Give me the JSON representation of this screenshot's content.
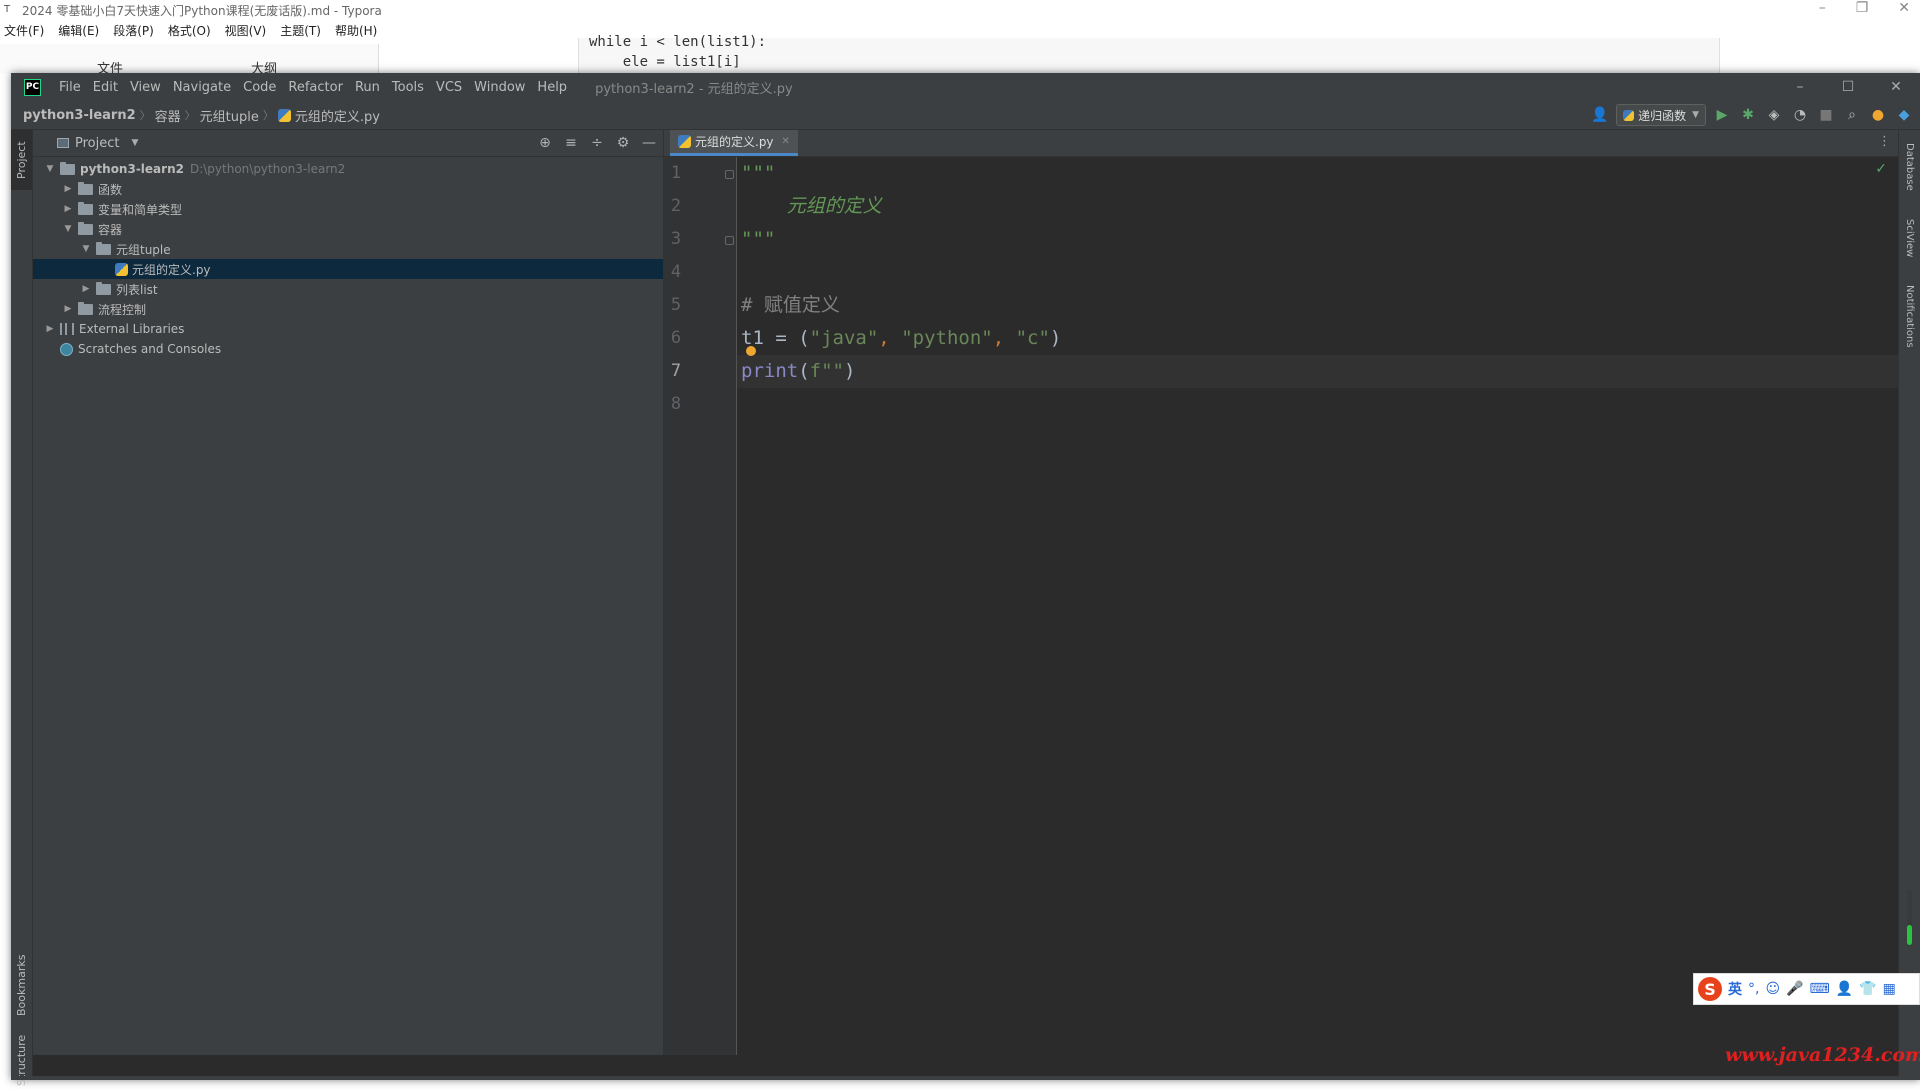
{
  "typora": {
    "title": "2024 零基础小白7天快速入门Python课程(无废话版).md - Typora",
    "menu": [
      "文件(F)",
      "编辑(E)",
      "段落(P)",
      "格式(O)",
      "视图(V)",
      "主题(T)",
      "帮助(H)"
    ],
    "sidebar_tabs": [
      "文件",
      "大纲"
    ],
    "code_lines": [
      "while i < len(list1):",
      "    ele = list1[i]"
    ]
  },
  "pycharm": {
    "logo": "PC",
    "menu": [
      "File",
      "Edit",
      "View",
      "Navigate",
      "Code",
      "Refactor",
      "Run",
      "Tools",
      "VCS",
      "Window",
      "Help"
    ],
    "window_title": "python3-learn2 - 元组的定义.py",
    "breadcrumb": [
      "python3-learn2",
      "容器",
      "元组tuple",
      "元组的定义.py"
    ],
    "run_config": "递归函数",
    "left_tabs": [
      "Project",
      "Bookmarks",
      "Structure"
    ],
    "right_tabs": [
      "Database",
      "SciView",
      "Notifications"
    ],
    "project_panel": {
      "title": "Project",
      "tree": [
        {
          "label": "python3-learn2",
          "path": "D:\\python\\python3-learn2",
          "expanded": true
        },
        {
          "label": "函数"
        },
        {
          "label": "变量和简单类型"
        },
        {
          "label": "容器",
          "expanded": true
        },
        {
          "label": "元组tuple",
          "expanded": true
        },
        {
          "label": "元组的定义.py",
          "selected": true
        },
        {
          "label": "列表list"
        },
        {
          "label": "流程控制"
        },
        {
          "label": "External Libraries"
        },
        {
          "label": "Scratches and Consoles"
        }
      ]
    },
    "editor": {
      "tab_label": "元组的定义.py",
      "line_numbers": [
        "1",
        "2",
        "3",
        "4",
        "5",
        "6",
        "7",
        "8"
      ],
      "lines": {
        "l1": "\"\"\"",
        "l2": "    元组的定义",
        "l3": "\"\"\"",
        "l5": "# 赋值定义",
        "l6_var": "t1",
        "l6_eq": " = (",
        "l6_s1": "\"java\"",
        "l6_c1": ", ",
        "l6_s2": "\"python\"",
        "l6_c2": ", ",
        "l6_s3": "\"c\"",
        "l6_end": ")",
        "l7_fn": "print",
        "l7_open": "(",
        "l7_str": "f\"\"",
        "l7_close": ")"
      },
      "current_line": 7
    }
  },
  "ime": {
    "lang": "英",
    "items": [
      "°,",
      "☺",
      "🎤",
      "⌨",
      "👤",
      "👕",
      "▦"
    ]
  },
  "watermark": "www.java1234.com",
  "colors": {
    "editor_bg": "#2b2b2b",
    "panel_bg": "#3c3f41",
    "selection": "#0d293e",
    "string": "#6a8759",
    "docstring": "#629755",
    "comment": "#808080",
    "builtin": "#8888c6",
    "accent": "#4a88c7"
  }
}
